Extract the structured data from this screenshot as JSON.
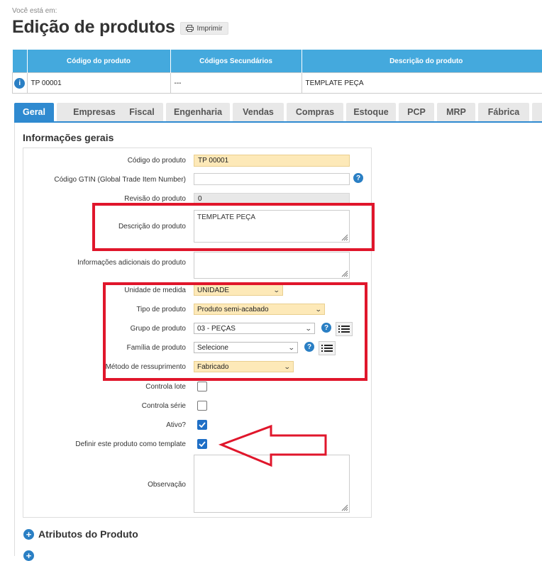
{
  "breadcrumb": "Você está em:",
  "page_title": "Edição de produtos",
  "print_label": "Imprimir",
  "product_table": {
    "headers": [
      "Código do produto",
      "Códigos Secundários",
      "Descrição do produto"
    ],
    "row": {
      "code": "TP 00001",
      "secondary": "---",
      "description": "TEMPLATE PEÇA"
    }
  },
  "tabs": [
    "Geral",
    "Empresas",
    "Fiscal",
    "Engenharia",
    "Vendas",
    "Compras",
    "Estoque",
    "PCP",
    "MRP",
    "Fábrica"
  ],
  "active_tab": "Geral",
  "section_title": "Informações gerais",
  "form": {
    "codigo_label": "Código do produto",
    "codigo_value": "TP 00001",
    "gtin_label": "Código GTIN (Global Trade Item Number)",
    "gtin_value": "",
    "revisao_label": "Revisão do produto",
    "revisao_value": "0",
    "descricao_label": "Descrição do produto",
    "descricao_value": "TEMPLATE PEÇA",
    "info_adic_label": "Informações adicionais do produto",
    "info_adic_value": "",
    "unidade_label": "Unidade de medida",
    "unidade_value": "UNIDADE",
    "tipo_label": "Tipo de produto",
    "tipo_value": "Produto semi-acabado",
    "grupo_label": "Grupo de produto",
    "grupo_value": "03 - PEÇAS",
    "familia_label": "Família de produto",
    "familia_value": "Selecione",
    "metodo_label": "Método de ressuprimento",
    "metodo_value": "Fabricado",
    "controla_lote_label": "Controla lote",
    "controla_lote_checked": false,
    "controla_serie_label": "Controla série",
    "controla_serie_checked": false,
    "ativo_label": "Ativo?",
    "ativo_checked": true,
    "template_label": "Definir este produto como template",
    "template_checked": true,
    "observacao_label": "Observação",
    "observacao_value": ""
  },
  "accordions": [
    "Atributos do Produto"
  ],
  "colors": {
    "accent": "#2f8ad0",
    "table_header": "#44a9dd",
    "required_field": "#fde9b8",
    "annotation": "#e0162b"
  }
}
